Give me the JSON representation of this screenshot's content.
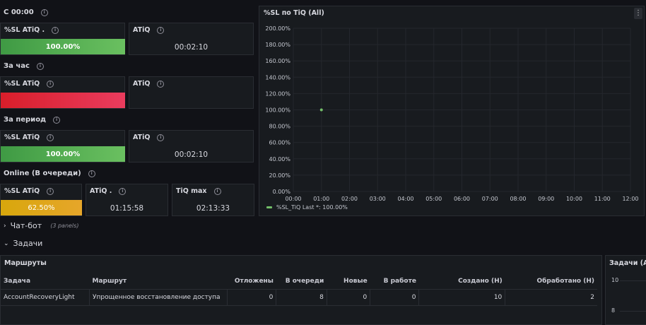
{
  "rows": {
    "c00": "С 00:00",
    "hour": "За час",
    "period": "За период",
    "online": "Online (В очереди)"
  },
  "stat1": {
    "sl_title": "%SL ATiQ .",
    "sl_value": "100.00%",
    "sl_color": "#5cb85c",
    "atiq_title": "ATiQ",
    "atiq_value": "00:02:10"
  },
  "stat2": {
    "sl_title": "%SL ATiQ",
    "sl_value": "",
    "sl_color": "#e02f44",
    "atiq_title": "ATiQ",
    "atiq_value": ""
  },
  "stat3": {
    "sl_title": "%SL ATiQ",
    "sl_value": "100.00%",
    "sl_color": "#5cb85c",
    "atiq_title": "ATiQ",
    "atiq_value": "00:02:10"
  },
  "stat4": {
    "sl_title": "%SL ATiQ",
    "sl_value": "62.50%",
    "sl_color": "#e0b400",
    "atiq_title": "ATiQ .",
    "atiq_value": "01:15:58",
    "tiqmax_title": "TiQ max",
    "tiqmax_value": "02:13:33"
  },
  "chart_panel": {
    "title": "%SL по TiQ (All)",
    "menu_icon": "kebab-menu-icon"
  },
  "chart_data": {
    "type": "scatter",
    "x_tick_labels": [
      "00:00",
      "01:00",
      "02:00",
      "03:00",
      "04:00",
      "05:00",
      "06:00",
      "07:00",
      "08:00",
      "09:00",
      "10:00",
      "11:00",
      "12:00"
    ],
    "y_tick_labels": [
      "0.00%",
      "20.00%",
      "40.00%",
      "60.00%",
      "80.00%",
      "100.00%",
      "120.00%",
      "140.00%",
      "160.00%",
      "180.00%",
      "200.00%"
    ],
    "ylim": [
      0,
      200
    ],
    "xlim_hours": [
      0,
      12
    ],
    "series": [
      {
        "name": "%SL_TiQ",
        "color": "#73bf69",
        "points": [
          {
            "x": "01:00",
            "y": 100
          }
        ]
      }
    ],
    "legend": {
      "text": "%SL_TiQ  Last *: 100.00%",
      "placement": "bottom-left"
    },
    "grid": true
  },
  "sections": {
    "chatbot": "Чат-бот",
    "chatbot_count": "(3 panels)",
    "tasks": "Задачи"
  },
  "routes_table": {
    "title": "Маршруты",
    "columns": [
      "Задача",
      "Маршрут",
      "Отложены",
      "В очереди",
      "Новые",
      "В работе",
      "Создано (Н)",
      "Обработано (Н)"
    ],
    "rows": [
      [
        "AccountRecoveryLight",
        "Упрощенное восстановление доступа",
        "0",
        "8",
        "0",
        "0",
        "10",
        "2"
      ]
    ]
  },
  "tasks_panel": {
    "title": "Задачи (All",
    "y_labels": [
      "10",
      "8"
    ]
  }
}
